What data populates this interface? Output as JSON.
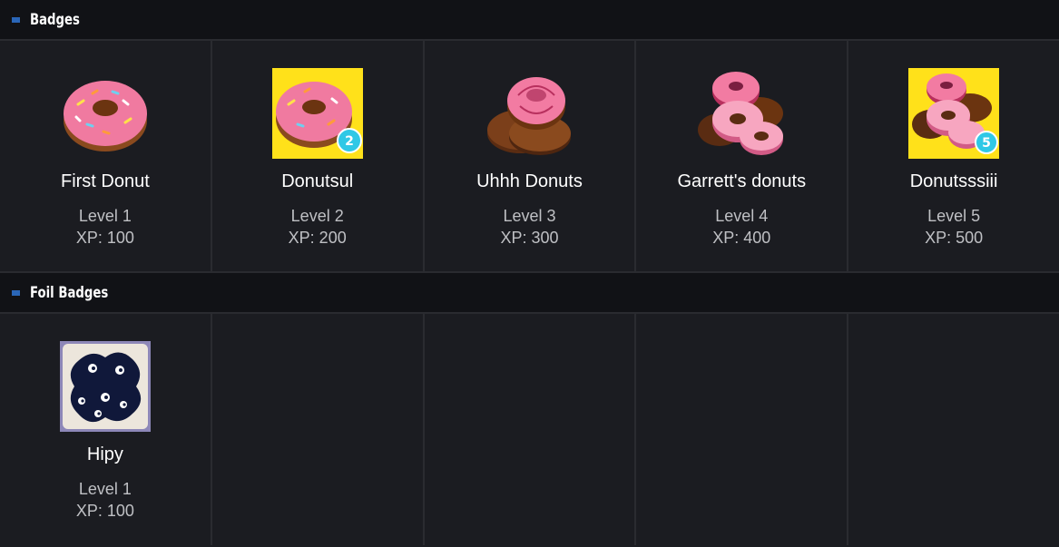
{
  "sections": [
    {
      "title": "Badges",
      "badges": [
        {
          "name": "First Donut",
          "level": "Level 1",
          "xp": "XP: 100",
          "icon": "donut-icon"
        },
        {
          "name": "Donutsul",
          "level": "Level 2",
          "xp": "XP: 200",
          "icon": "donut-level-2-icon",
          "count": "2"
        },
        {
          "name": "Uhhh Donuts",
          "level": "Level 3",
          "xp": "XP: 300",
          "icon": "donut-stack-icon"
        },
        {
          "name": "Garrett's donuts",
          "level": "Level 4",
          "xp": "XP: 400",
          "icon": "donut-pile-icon"
        },
        {
          "name": "Donutsssiii",
          "level": "Level 5",
          "xp": "XP: 500",
          "icon": "donut-pile-level-5-icon",
          "count": "5"
        }
      ]
    },
    {
      "title": "Foil Badges",
      "badges": [
        {
          "name": "Hipy",
          "level": "Level 1",
          "xp": "XP: 100",
          "icon": "ink-blob-eyes-icon"
        }
      ]
    }
  ],
  "colors": {
    "background": "#1b1c21",
    "header": "#111216",
    "accent": "#2a66b8"
  }
}
